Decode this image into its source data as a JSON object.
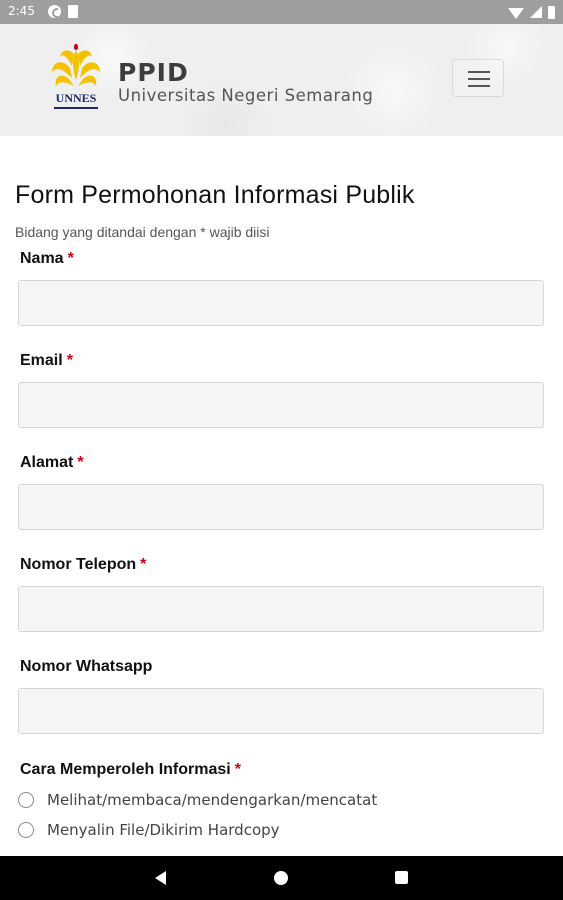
{
  "status_bar": {
    "time": "2:45"
  },
  "header": {
    "logo_text": "UNNES",
    "title": "PPID",
    "subtitle": "Universitas Negeri Semarang",
    "colors": {
      "logo_yellow": "#f5c200",
      "logo_blue": "#1a2a6c"
    }
  },
  "form": {
    "title": "Form Permohonan Informasi Publik",
    "note": "Bidang yang ditandai dengan * wajib diisi",
    "required_marker": "*",
    "fields": [
      {
        "label": "Nama",
        "value": "",
        "placeholder": ""
      },
      {
        "label": "Email",
        "value": "",
        "placeholder": ""
      },
      {
        "label": "Alamat",
        "value": "",
        "placeholder": ""
      },
      {
        "label": "Nomor Telepon",
        "value": "",
        "placeholder": ""
      },
      {
        "label": "Nomor Whatsapp",
        "value": "",
        "placeholder": ""
      }
    ],
    "cara_memperoleh": {
      "label": "Cara Memperoleh Informasi",
      "options": [
        {
          "label": "Melihat/membaca/mendengarkan/mencatat",
          "selected": false
        },
        {
          "label": "Menyalin File/Dikirim Hardcopy",
          "selected": false
        }
      ]
    }
  }
}
